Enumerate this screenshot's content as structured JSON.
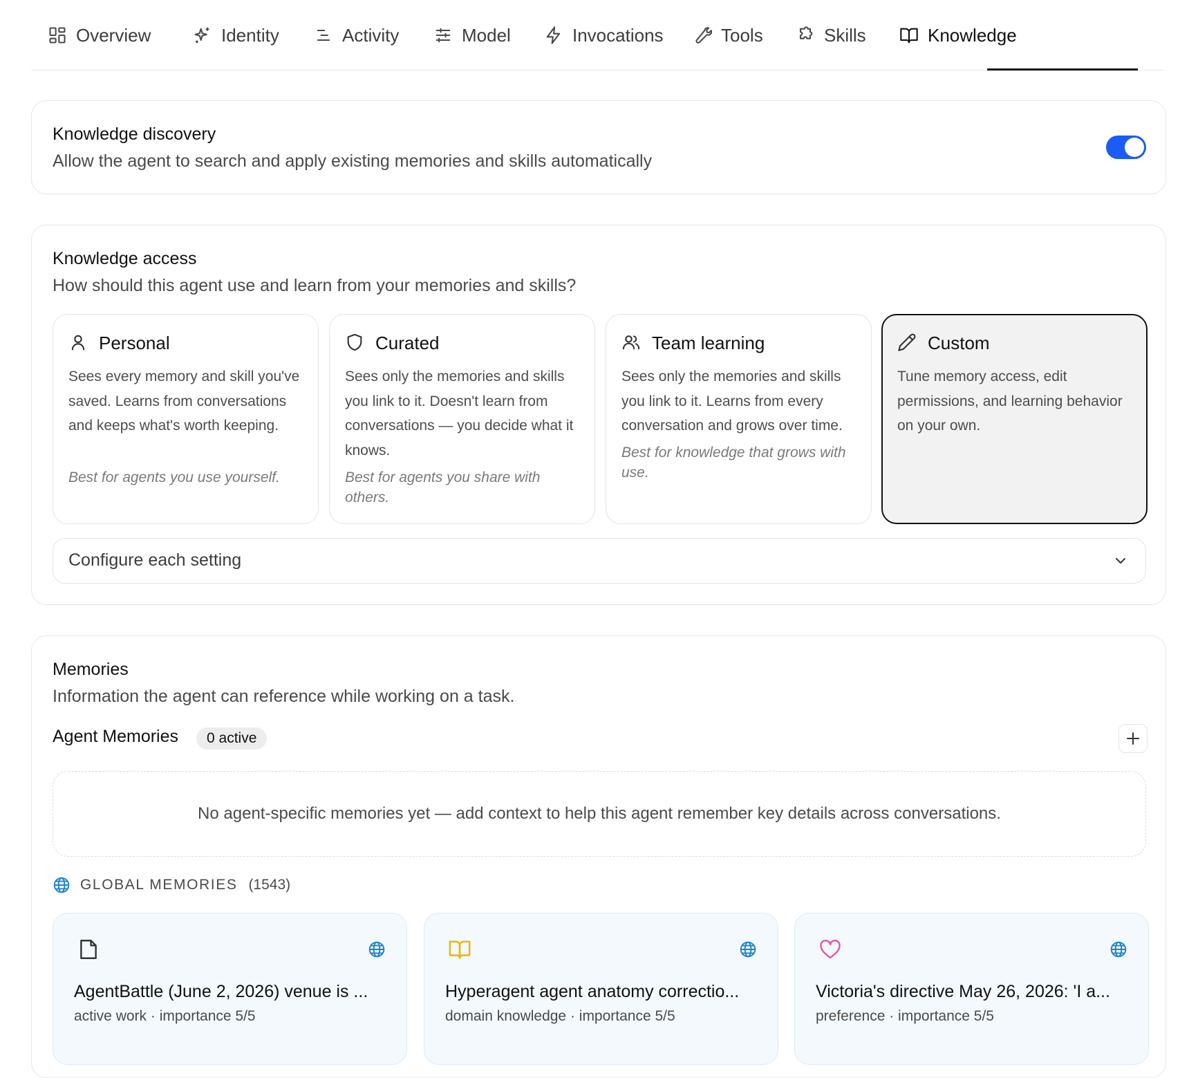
{
  "tabs": [
    {
      "label": "Overview",
      "icon": "grid-icon"
    },
    {
      "label": "Identity",
      "icon": "sparkles-icon"
    },
    {
      "label": "Activity",
      "icon": "text-lines-icon"
    },
    {
      "label": "Model",
      "icon": "sliders-icon"
    },
    {
      "label": "Invocations",
      "icon": "lightning-icon"
    },
    {
      "label": "Tools",
      "icon": "wrench-icon"
    },
    {
      "label": "Skills",
      "icon": "puzzle-icon"
    },
    {
      "label": "Knowledge",
      "icon": "book-icon",
      "active": true
    }
  ],
  "discovery": {
    "title": "Knowledge discovery",
    "subtitle": "Allow the agent to search and apply existing memories and skills automatically",
    "enabled": true,
    "toggle_color": "#1a5cf5"
  },
  "access": {
    "title": "Knowledge access",
    "subtitle": "How should this agent use and learn from your memories and skills?",
    "options": [
      {
        "title": "Personal",
        "icon": "user-icon",
        "description": "Sees every memory and skill you've saved. Learns from conversations and keeps what's worth keeping.",
        "best_for": "Best for agents you use yourself."
      },
      {
        "title": "Curated",
        "icon": "shield-icon",
        "description": "Sees only the memories and skills you link to it. Doesn't learn from conversations — you decide what it knows.",
        "best_for": "Best for agents you share with others."
      },
      {
        "title": "Team learning",
        "icon": "users-icon",
        "description": "Sees only the memories and skills you link to it. Learns from every conversation and grows over time.",
        "best_for": "Best for knowledge that grows with use."
      },
      {
        "title": "Custom",
        "icon": "pencil-icon",
        "description": "Tune memory access, edit permissions, and learning behavior on your own.",
        "best_for": "",
        "selected": true
      }
    ],
    "configure_label": "Configure each setting"
  },
  "memories": {
    "title": "Memories",
    "subtitle": "Information the agent can reference while working on a task.",
    "agent_memories_label": "Agent Memories",
    "active_badge": "0 active",
    "empty_text": "No agent-specific memories yet — add context to help this agent remember key details across conversations.",
    "global_label": "GLOBAL MEMORIES",
    "global_count": "(1543)",
    "global_color": "#1a84cc",
    "cards": [
      {
        "icon": "document-icon",
        "icon_color": "#333333",
        "title": "AgentBattle (June 2, 2026) venue is ...",
        "meta": "active work · importance 5/5"
      },
      {
        "icon": "book-icon",
        "icon_color": "#f0b400",
        "title": "Hyperagent agent anatomy correctio...",
        "meta": "domain knowledge · importance 5/5"
      },
      {
        "icon": "heart-icon",
        "icon_color": "#e754a6",
        "title": "Victoria's directive May 26, 2026: 'I a...",
        "meta": "preference · importance 5/5"
      }
    ]
  }
}
